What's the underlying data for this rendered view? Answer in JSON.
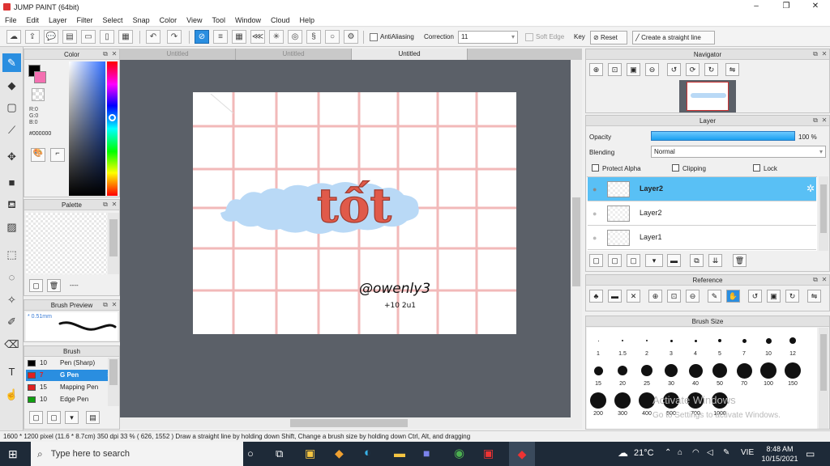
{
  "window": {
    "title": "JUMP PAINT (64bit)",
    "controls": [
      "–",
      "❐",
      "✕"
    ]
  },
  "menu": [
    "File",
    "Edit",
    "Layer",
    "Filter",
    "Select",
    "Snap",
    "Color",
    "View",
    "Tool",
    "Window",
    "Cloud",
    "Help"
  ],
  "toolbar": {
    "antialiasing_label": "AntiAliasing",
    "correction_label": "Correction",
    "correction_value": "11",
    "soft_edge_label": "Soft Edge",
    "key_label": "Key",
    "reset_label": "Reset",
    "straight_line_label": "Create a straight line"
  },
  "tabs": [
    "Untitled",
    "Untitled",
    "Untitled"
  ],
  "color_panel": {
    "title": "Color",
    "r": "R:0",
    "g": "G:0",
    "b": "B:0",
    "hex": "#000000"
  },
  "palette_panel": {
    "title": "Palette",
    "dashes": "----"
  },
  "brush_preview": {
    "title": "Brush Preview",
    "size": "* 0.51mm"
  },
  "brush_panel": {
    "title": "Brush",
    "items": [
      {
        "size": "10",
        "name": "Pen (Sharp)",
        "color": "#000000"
      },
      {
        "size": "7",
        "name": "G Pen",
        "color": "#e02020"
      },
      {
        "size": "15",
        "name": "Mapping Pen",
        "color": "#e02020"
      },
      {
        "size": "10",
        "name": "Edge Pen",
        "color": "#10a010"
      }
    ]
  },
  "canvas": {
    "title_art": "tốt",
    "signature": "@owenly3",
    "signature_sub": "+10 2u1"
  },
  "navigator": {
    "title": "Navigator"
  },
  "layer_panel": {
    "title": "Layer",
    "opacity_label": "Opacity",
    "opacity_value": "100 %",
    "opacity": 1.0,
    "blending_label": "Blending",
    "blending_value": "Normal",
    "protect_alpha": "Protect Alpha",
    "clipping": "Clipping",
    "lock": "Lock",
    "layers": [
      "Layer2",
      "Layer2",
      "Layer1"
    ]
  },
  "reference": {
    "title": "Reference"
  },
  "brush_size": {
    "title": "Brush Size",
    "row1": [
      "1",
      "1.5",
      "2",
      "3",
      "4",
      "5",
      "7",
      "10",
      "12"
    ],
    "row2": [
      "15",
      "20",
      "25",
      "30",
      "40",
      "50",
      "70",
      "100",
      "150"
    ],
    "row3": [
      "200",
      "300",
      "400",
      "500",
      "700",
      "1000"
    ],
    "watermark1": "Activate Windows",
    "watermark2": "Go to Settings to activate Windows."
  },
  "status": {
    "text": "1600 * 1200 pixel   (11.6 * 8.7cm)   350 dpi   33 %   ( 626, 1552 )   Draw a straight line by holding down Shift, Change a brush size by holding down Ctrl, Alt, and dragging"
  },
  "taskbar": {
    "search_placeholder": "Type here to search",
    "temperature": "21°C",
    "language": "VIE",
    "time": "8:48 AM",
    "date": "10/15/2021"
  },
  "colors": {
    "accent": "#2a8ee0",
    "selection": "#59c0f5",
    "grid": "#f2b9b9",
    "cloud": "#b9d9f6",
    "letter": "#e05a4a"
  }
}
